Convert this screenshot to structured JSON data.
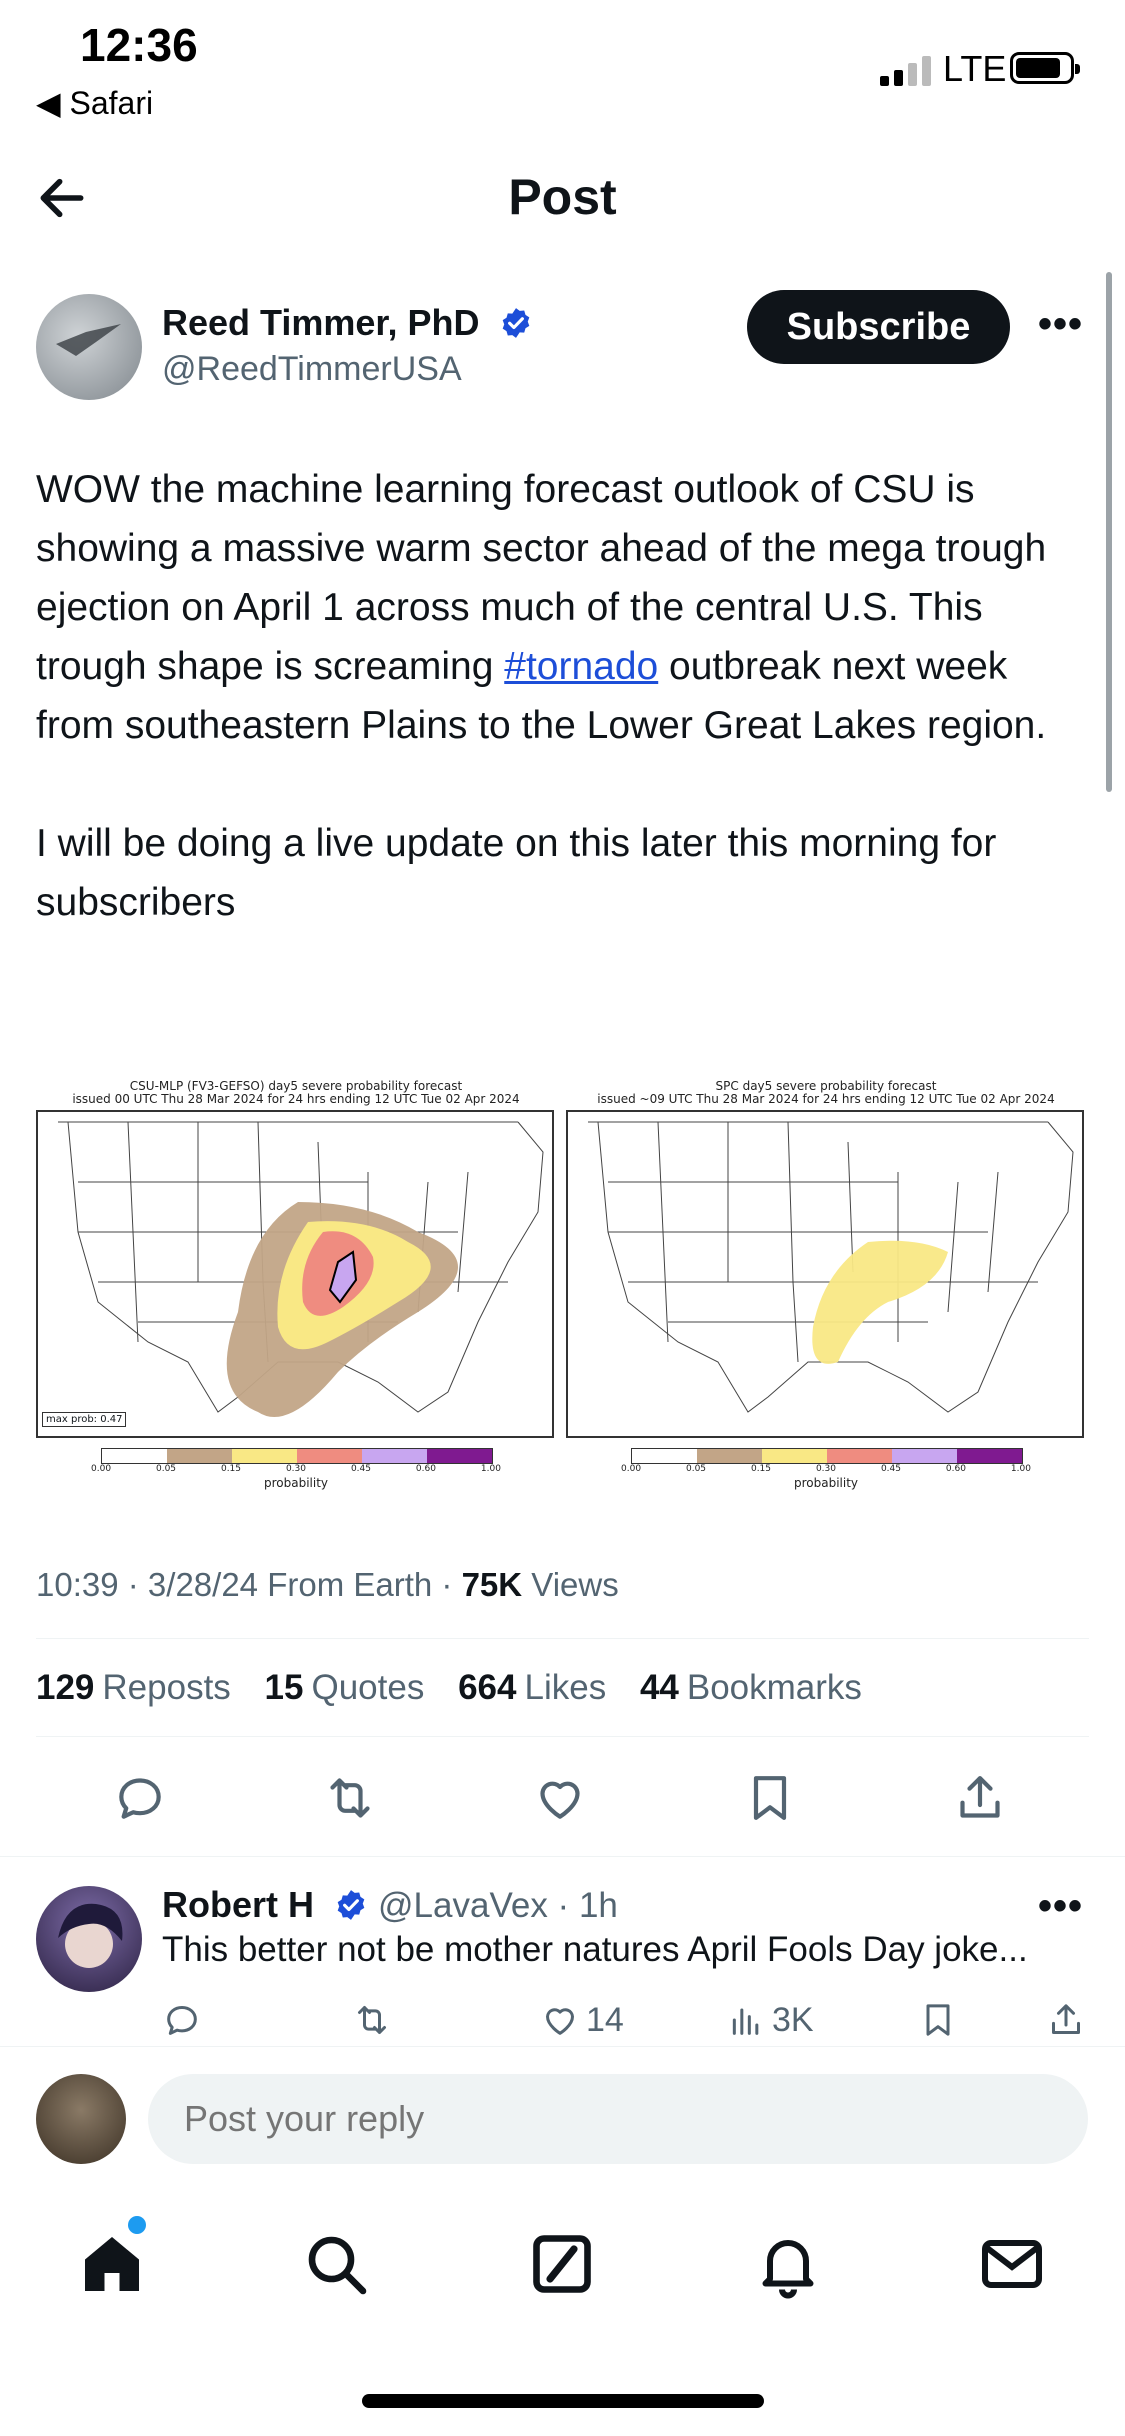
{
  "status_bar": {
    "time": "12:36",
    "back_app": "◀ Safari",
    "network": "LTE"
  },
  "header": {
    "title": "Post"
  },
  "post": {
    "author_name": "Reed Timmer, PhD",
    "author_handle": "@ReedTimmerUSA",
    "subscribe_label": "Subscribe",
    "text_part1": "WOW the machine learning forecast outlook of CSU is showing a massive warm sector ahead of the mega trough ejection on April 1 across much of the central U.S. This trough shape is screaming ",
    "hashtag": "#tornado",
    "text_part2": " outbreak next week from southeastern Plains to the Lower Great Lakes region.",
    "text_para2": "I will be doing a live update on this later this morning for subscribers",
    "image": {
      "left_title_line1": "CSU-MLP (FV3-GEFSO) day5 severe probability forecast",
      "left_title_line2": "issued 00 UTC Thu 28 Mar 2024 for 24 hrs ending 12 UTC Tue 02 Apr 2024",
      "right_title_line1": "SPC day5 severe probability forecast",
      "right_title_line2": "issued ~09 UTC Thu 28 Mar 2024 for 24 hrs ending 12 UTC Tue 02 Apr 2024",
      "max_prob_label": "max prob: 0.47",
      "legend_ticks": [
        "0.00",
        "0.05",
        "0.15",
        "0.30",
        "0.45",
        "0.60",
        "1.00"
      ],
      "legend_label": "probability",
      "legend_colors": [
        "#ffffff",
        "#c2a587",
        "#f9e885",
        "#ef8c80",
        "#c8a6f0",
        "#7f1a90"
      ]
    },
    "time": "10:39",
    "date": "3/28/24",
    "source": "From Earth",
    "views_count": "75K",
    "views_label": "Views",
    "reposts_count": "129",
    "reposts_label": "Reposts",
    "quotes_count": "15",
    "quotes_label": "Quotes",
    "likes_count": "664",
    "likes_label": "Likes",
    "bookmarks_count": "44",
    "bookmarks_label": "Bookmarks"
  },
  "reply": {
    "name": "Robert H",
    "handle_time": "@LavaVex · 1h",
    "text": "This better not be mother natures April Fools Day joke...",
    "likes": "14",
    "views": "3K"
  },
  "compose": {
    "placeholder": "Post your reply"
  },
  "colors": {
    "accent": "#1d9bf0",
    "link": "#1d4ed8",
    "text": "#0f1419",
    "muted": "#536471"
  }
}
